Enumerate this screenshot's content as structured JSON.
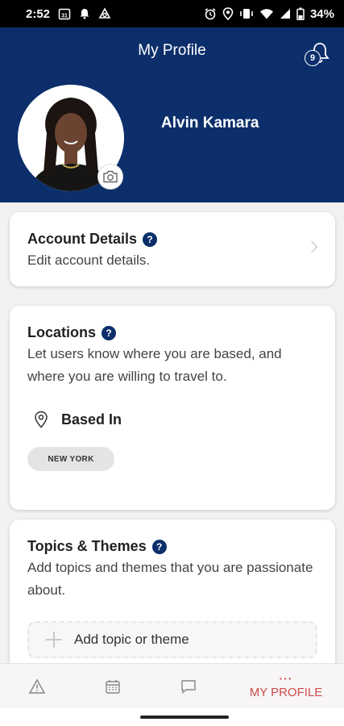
{
  "status_bar": {
    "time": "2:52",
    "calendar_day": "31",
    "battery": "34%"
  },
  "header": {
    "title": "My Profile",
    "notification_count": "9"
  },
  "profile": {
    "name": "Alvin Kamara"
  },
  "account_details": {
    "title": "Account Details",
    "description": "Edit account details."
  },
  "locations": {
    "title": "Locations",
    "description": "Let users know where you are based, and where you are willing to travel to.",
    "based_in_label": "Based In",
    "based_in_chip": "NEW YORK"
  },
  "topics": {
    "title": "Topics & Themes",
    "description": "Add topics and themes that you are passionate about.",
    "add_label": "Add topic or theme"
  },
  "bottom_nav": {
    "profile_dots": "···",
    "profile_label": "MY PROFILE"
  },
  "icons": {
    "help": "?",
    "chevron": "chevron-right-icon",
    "bell": "bell-icon",
    "camera": "camera-icon",
    "pin": "location-pin-icon",
    "plus": "plus-icon",
    "alert": "alert-icon",
    "calendar": "calendar-icon",
    "chat": "chat-icon"
  },
  "colors": {
    "brand_navy": "#0c2f6b",
    "accent_red": "#d04a4a"
  }
}
